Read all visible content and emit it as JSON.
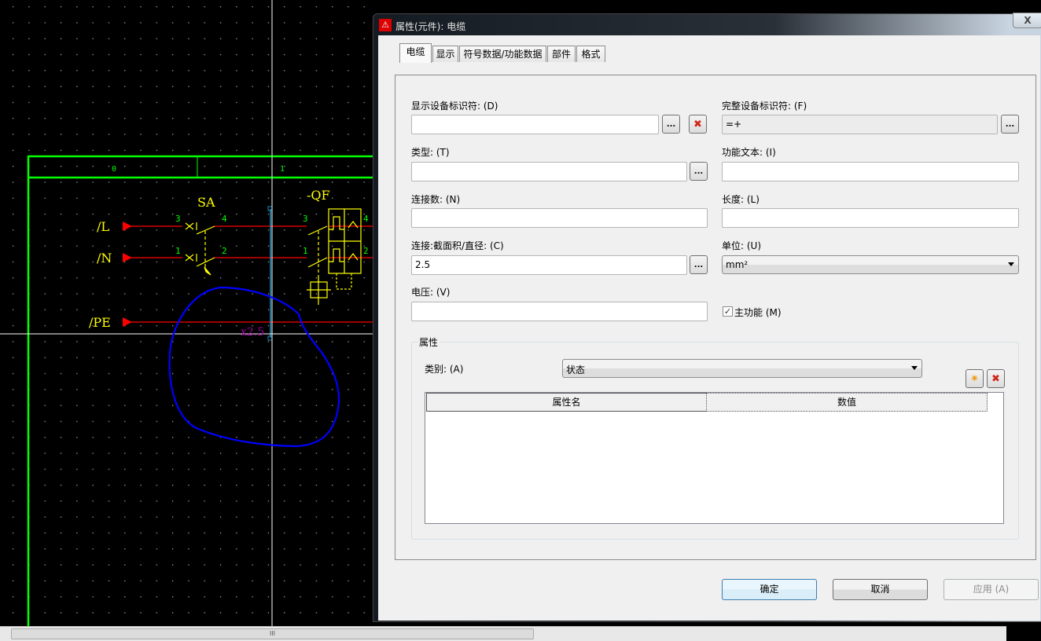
{
  "canvas": {
    "column_labels": [
      "0",
      "1"
    ],
    "potentials": [
      "/L",
      "/N",
      "/PE"
    ],
    "components": {
      "switch": "SA",
      "breaker": "-QF"
    },
    "pin_labels": {
      "sa_top": [
        "3",
        "4"
      ],
      "sa_bottom": [
        "1",
        "2"
      ],
      "qf_top": [
        "3",
        "4"
      ],
      "qf_bottom": [
        "1",
        "2"
      ]
    },
    "cable_label": "x2.5",
    "colors": {
      "frame": "#00ff00",
      "wire": "#ff0000",
      "symbol": "#ffff00",
      "annotation": "#0000ff",
      "cable_label": "#a000a0"
    }
  },
  "dialog": {
    "title": "属性(元件): 电缆",
    "close_label": "X",
    "tabs": [
      {
        "label": "电缆",
        "selected": true
      },
      {
        "label": "显示",
        "selected": false
      },
      {
        "label": "符号数据/功能数据",
        "selected": false
      },
      {
        "label": "部件",
        "selected": false
      },
      {
        "label": "格式",
        "selected": false
      }
    ],
    "fields": {
      "display_dt": {
        "label": "显示设备标识符: (D)",
        "value": ""
      },
      "full_dt": {
        "label": "完整设备标识符: (F)",
        "value": "=+"
      },
      "type": {
        "label": "类型: (T)",
        "value": ""
      },
      "function_text": {
        "label": "功能文本: (I)",
        "value": ""
      },
      "connections": {
        "label": "连接数: (N)",
        "value": ""
      },
      "length": {
        "label": "长度: (L)",
        "value": ""
      },
      "cross_section": {
        "label": "连接:截面积/直径: (C)",
        "value": "2.5"
      },
      "unit": {
        "label": "单位: (U)",
        "value": "mm²"
      },
      "voltage": {
        "label": "电压: (V)",
        "value": ""
      },
      "main_function": {
        "label": "主功能 (M)",
        "checked": true
      }
    },
    "browse_label": "...",
    "properties": {
      "group_title": "属性",
      "category_label": "类别: (A)",
      "category_value": "状态",
      "columns": [
        "属性名",
        "数值"
      ],
      "rows": []
    },
    "buttons": {
      "ok": "确定",
      "cancel": "取消",
      "apply": "应用 (A)"
    }
  },
  "scrollbar": {
    "grip": "III"
  }
}
